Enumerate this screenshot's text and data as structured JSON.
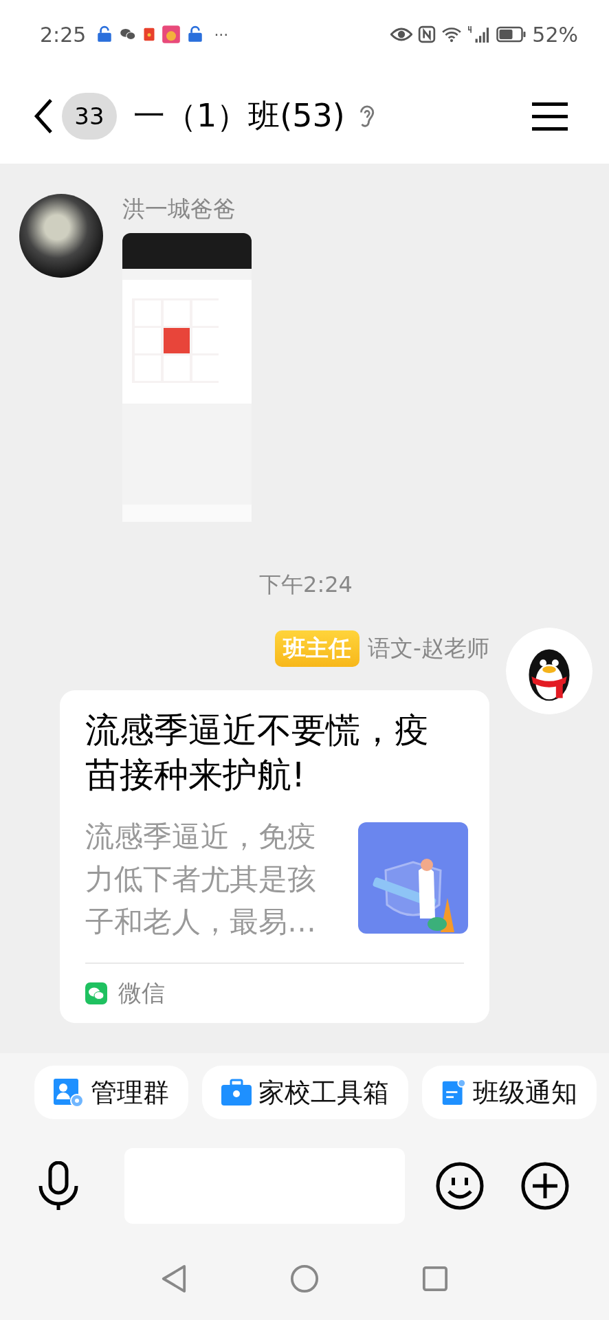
{
  "status_bar": {
    "time": "2:25",
    "more": "···",
    "battery": "52%"
  },
  "header": {
    "unread_count": "33",
    "title": "一（1）班(53)"
  },
  "messages": [
    {
      "kind": "image",
      "sender": "洪一城爸爸"
    },
    {
      "kind": "timestamp",
      "text": "下午2:24"
    },
    {
      "kind": "link_card",
      "role_badge": "班主任",
      "sender": "语文-赵老师",
      "title": "流感季逼近不要慌，疫苗接种来护航!",
      "description": "流感季逼近，免疫力低下者尤其是孩子和老人，最易…",
      "source": "微信"
    }
  ],
  "quick_actions": [
    {
      "label": "管理群",
      "kind": "admin"
    },
    {
      "label": "家校工具箱",
      "kind": "toolbox"
    },
    {
      "label": "班级通知",
      "kind": "notice"
    }
  ]
}
